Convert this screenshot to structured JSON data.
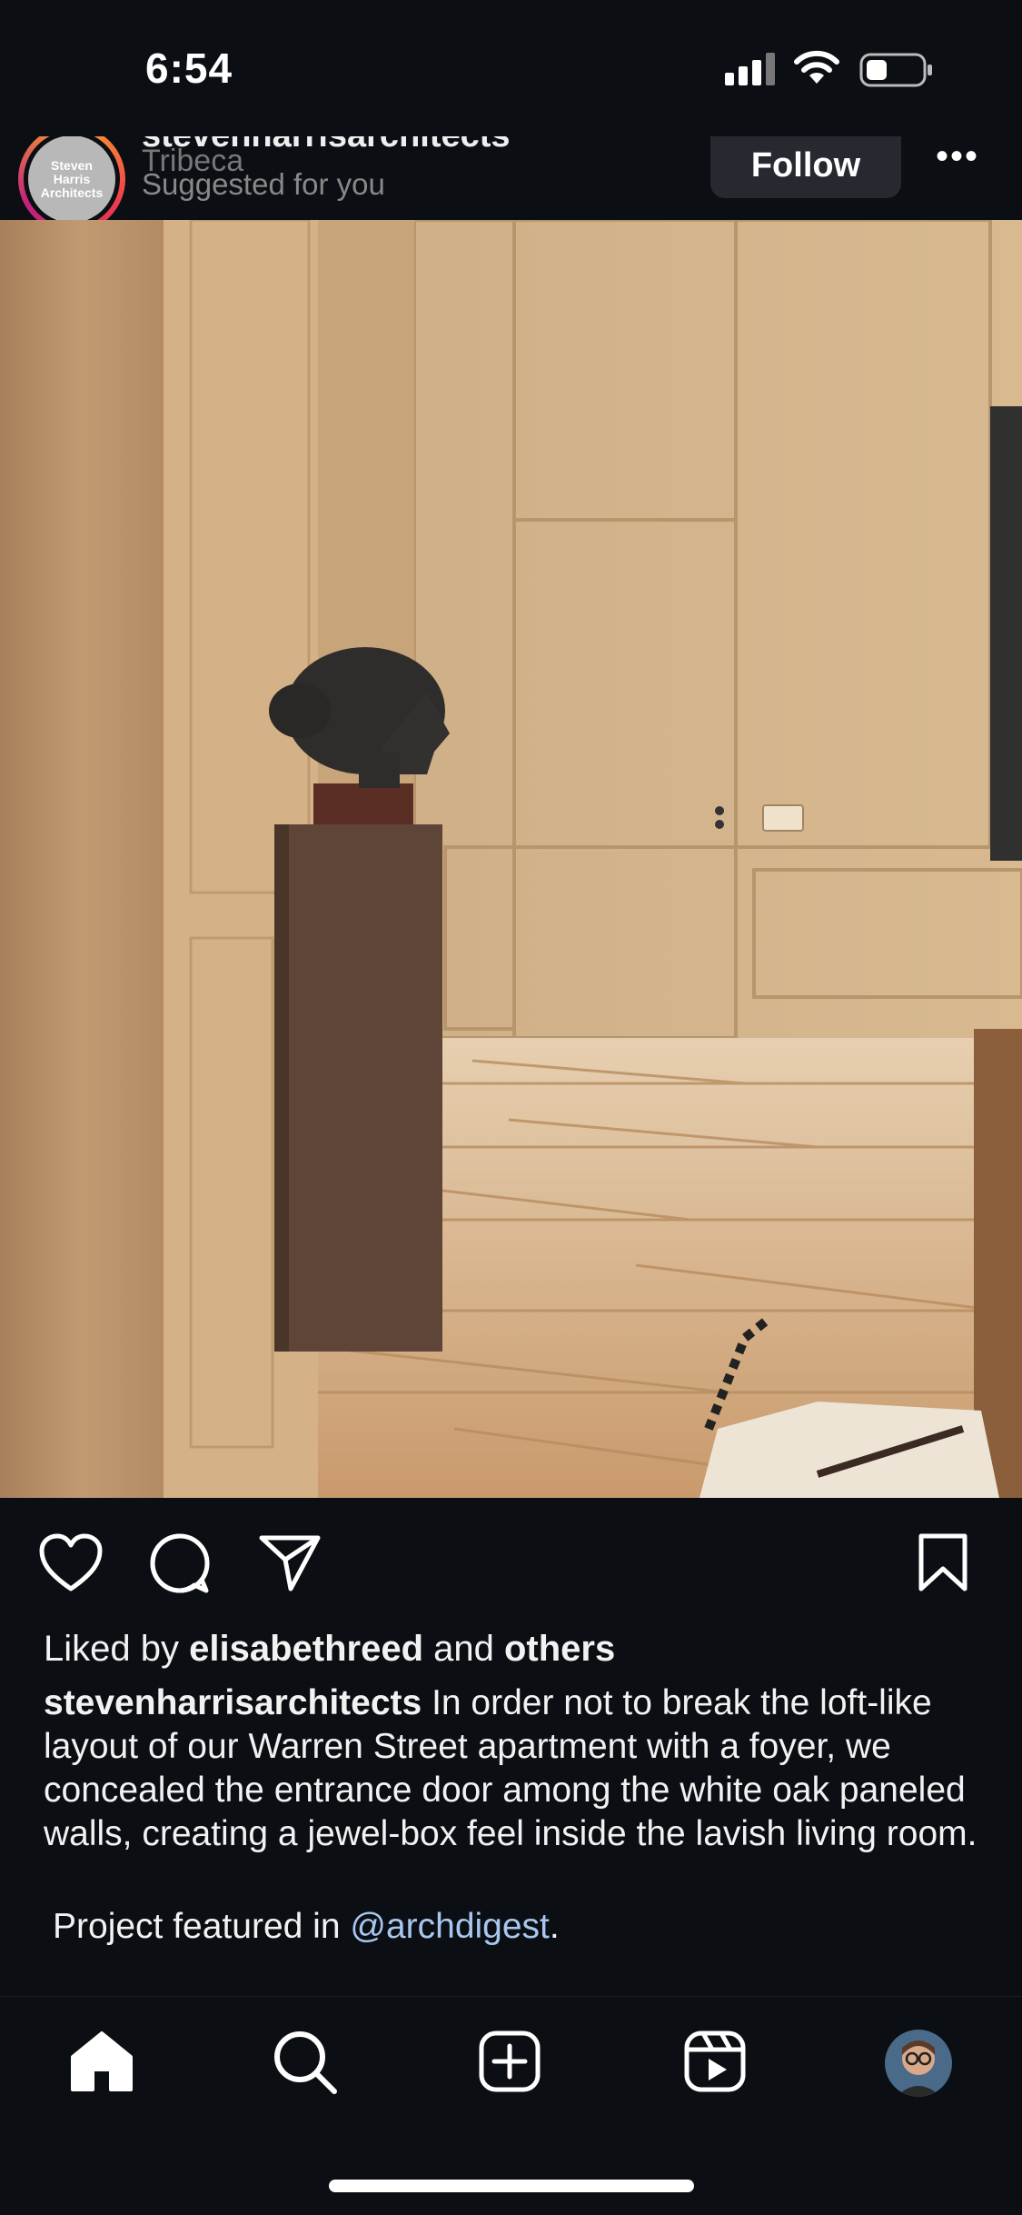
{
  "status_bar": {
    "time": "6:54"
  },
  "post": {
    "avatar_text": "Steven Harris Architects",
    "username": "stevenharrisarchitects",
    "location": "Tribeca",
    "suggested": "Suggested for you",
    "follow_label": "Follow",
    "more_label": "•••",
    "likes": {
      "prefix": "Liked by ",
      "user": "elisabethreed",
      "middle": " and ",
      "others": "others"
    },
    "caption": {
      "username": "stevenharrisarchitects",
      "text": " In order not to break the loft-like layout of our Warren Street apartment with a foyer,  we concealed the entrance door among the white oak paneled walls, creating a jewel-box feel inside the lavish living room.",
      "featured_prefix": "Project featured in ",
      "mention": "@archdigest",
      "featured_suffix": "."
    }
  },
  "icons": {
    "like": "heart-icon",
    "comment": "comment-icon",
    "share": "send-icon",
    "save": "bookmark-icon",
    "home": "home-icon",
    "search": "search-icon",
    "create": "plus-square-icon",
    "reels": "reels-icon",
    "profile": "profile-avatar"
  },
  "colors": {
    "background": "#0b0e13",
    "follow_button": "#262a30",
    "mention": "#a8c7f0",
    "story_ring": "#ee3a4c"
  }
}
